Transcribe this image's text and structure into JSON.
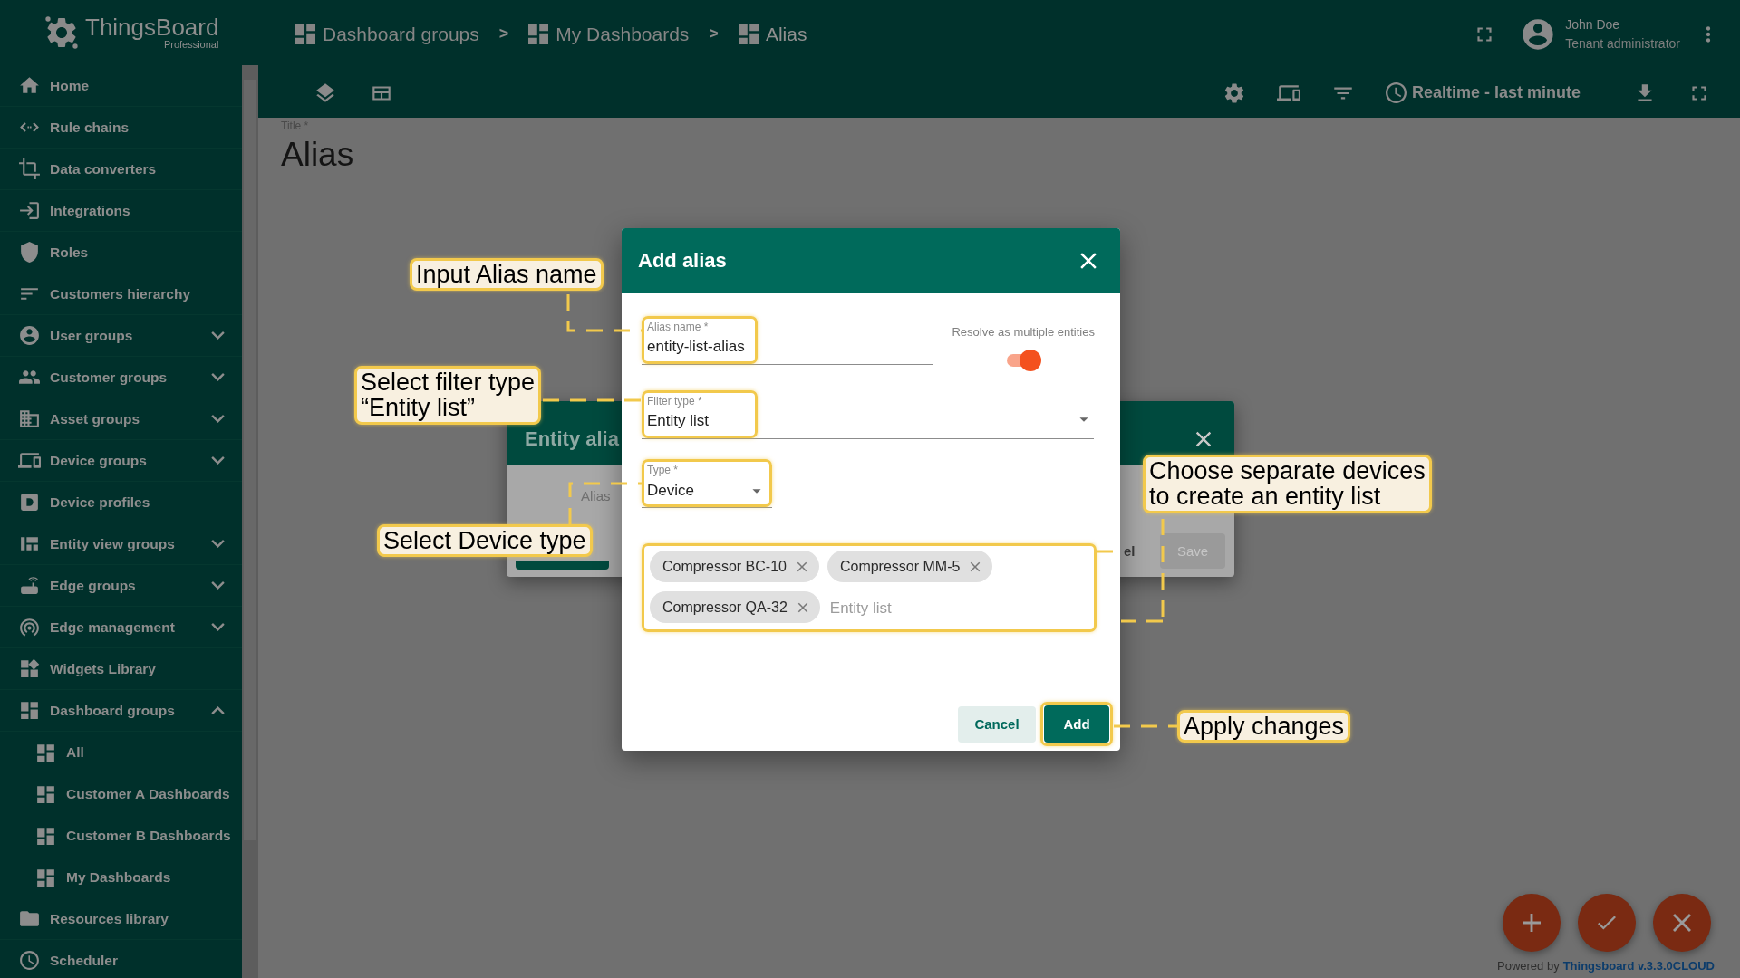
{
  "logo": {
    "title": "ThingsBoard",
    "subtitle": "Professional"
  },
  "sidebar": {
    "items": [
      {
        "label": "Home"
      },
      {
        "label": "Rule chains"
      },
      {
        "label": "Data converters"
      },
      {
        "label": "Integrations"
      },
      {
        "label": "Roles"
      },
      {
        "label": "Customers hierarchy"
      },
      {
        "label": "User groups",
        "expanded": false
      },
      {
        "label": "Customer groups",
        "expanded": false
      },
      {
        "label": "Asset groups",
        "expanded": false
      },
      {
        "label": "Device groups",
        "expanded": false
      },
      {
        "label": "Device profiles"
      },
      {
        "label": "Entity view groups",
        "expanded": false
      },
      {
        "label": "Edge groups",
        "expanded": false
      },
      {
        "label": "Edge management",
        "expanded": false
      },
      {
        "label": "Widgets Library"
      },
      {
        "label": "Dashboard groups",
        "expanded": true,
        "children": [
          {
            "label": "All"
          },
          {
            "label": "Customer A Dashboards"
          },
          {
            "label": "Customer B Dashboards"
          },
          {
            "label": "My Dashboards"
          }
        ]
      },
      {
        "label": "Resources library"
      },
      {
        "label": "Scheduler"
      }
    ]
  },
  "breadcrumbs": {
    "separator": ">",
    "items": [
      {
        "label": "Dashboard groups"
      },
      {
        "label": "My Dashboards"
      },
      {
        "label": "Alias"
      }
    ]
  },
  "user": {
    "name": "John Doe",
    "role": "Tenant administrator"
  },
  "toolbar": {
    "timewindow": "Realtime - last minute"
  },
  "dashboard": {
    "title_label": "Title *",
    "title": "Alias"
  },
  "background_dialog": {
    "title": "Entity alia",
    "field_label": "Alias",
    "cancel_fragment": "el",
    "save": "Save"
  },
  "dialog": {
    "title": "Add alias",
    "alias_field": {
      "label": "Alias name *",
      "value": "entity-list-alias"
    },
    "resolve": {
      "label": "Resolve as multiple entities",
      "on": true
    },
    "filter_field": {
      "label": "Filter type *",
      "value": "Entity list"
    },
    "type_field": {
      "label": "Type *",
      "value": "Device"
    },
    "entities": {
      "chips": [
        "Compressor BC-10",
        "Compressor MM-5",
        "Compressor QA-32"
      ],
      "placeholder": "Entity list"
    },
    "buttons": [
      {
        "label": "Cancel",
        "kind": "secondary"
      },
      {
        "label": "Add",
        "kind": "primary"
      }
    ]
  },
  "callouts": [
    {
      "text": "Input Alias name"
    },
    {
      "text": "Select filter type\n“Entity list”"
    },
    {
      "text": "Select Device type"
    },
    {
      "text": "Choose separate devices\nto create an entity list"
    },
    {
      "text": "Apply changes"
    }
  ],
  "footer": {
    "powered": "Powered by",
    "link": "Thingsboard v.3.3.0CLOUD"
  }
}
